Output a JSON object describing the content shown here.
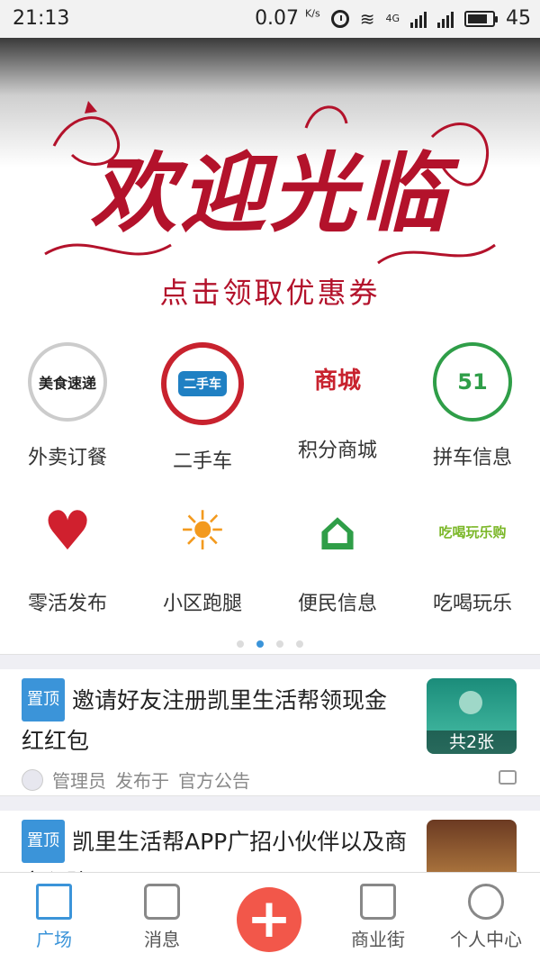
{
  "status_bar": {
    "time": "21:13",
    "speed": "0.07",
    "speed_unit": "K/s",
    "network": "4G",
    "battery": "45"
  },
  "banner": {
    "title": "欢迎光临",
    "subtitle": "点击领取优惠券"
  },
  "menu": {
    "items": [
      {
        "label": "外卖订餐",
        "icon": "food-delivery-icon",
        "icon_text": "美食速递"
      },
      {
        "label": "二手车",
        "icon": "used-car-icon",
        "icon_text": "二手车"
      },
      {
        "label": "积分商城",
        "icon": "points-mall-icon",
        "icon_text": "商城"
      },
      {
        "label": "拼车信息",
        "icon": "carpool-icon",
        "icon_text": "51"
      },
      {
        "label": "零活发布",
        "icon": "odd-jobs-icon",
        "icon_text": "♥"
      },
      {
        "label": "小区跑腿",
        "icon": "errand-icon",
        "icon_text": "☀"
      },
      {
        "label": "便民信息",
        "icon": "service-center-icon",
        "icon_text": "⌂"
      },
      {
        "label": "吃喝玩乐",
        "icon": "entertainment-icon",
        "icon_text": "吃喝玩乐购"
      }
    ],
    "page_count": 4,
    "active_page": 2
  },
  "posts": [
    {
      "pin": "置顶",
      "title": "邀请好友注册凯里生活帮领现金红红包",
      "thumb_caption": "共2张",
      "author": "管理员",
      "posted_in": "发布于",
      "category": "官方公告"
    },
    {
      "pin": "置顶",
      "title": "凯里生活帮APP广招小伙伴以及商家入驻"
    }
  ],
  "tabbar": {
    "tabs": [
      {
        "label": "广场",
        "active": true
      },
      {
        "label": "消息"
      },
      {
        "label": "商业街"
      },
      {
        "label": "个人中心"
      }
    ]
  },
  "colors": {
    "accent": "#3b94d9",
    "add_button": "#f2574a",
    "banner_red": "#b3122b"
  }
}
